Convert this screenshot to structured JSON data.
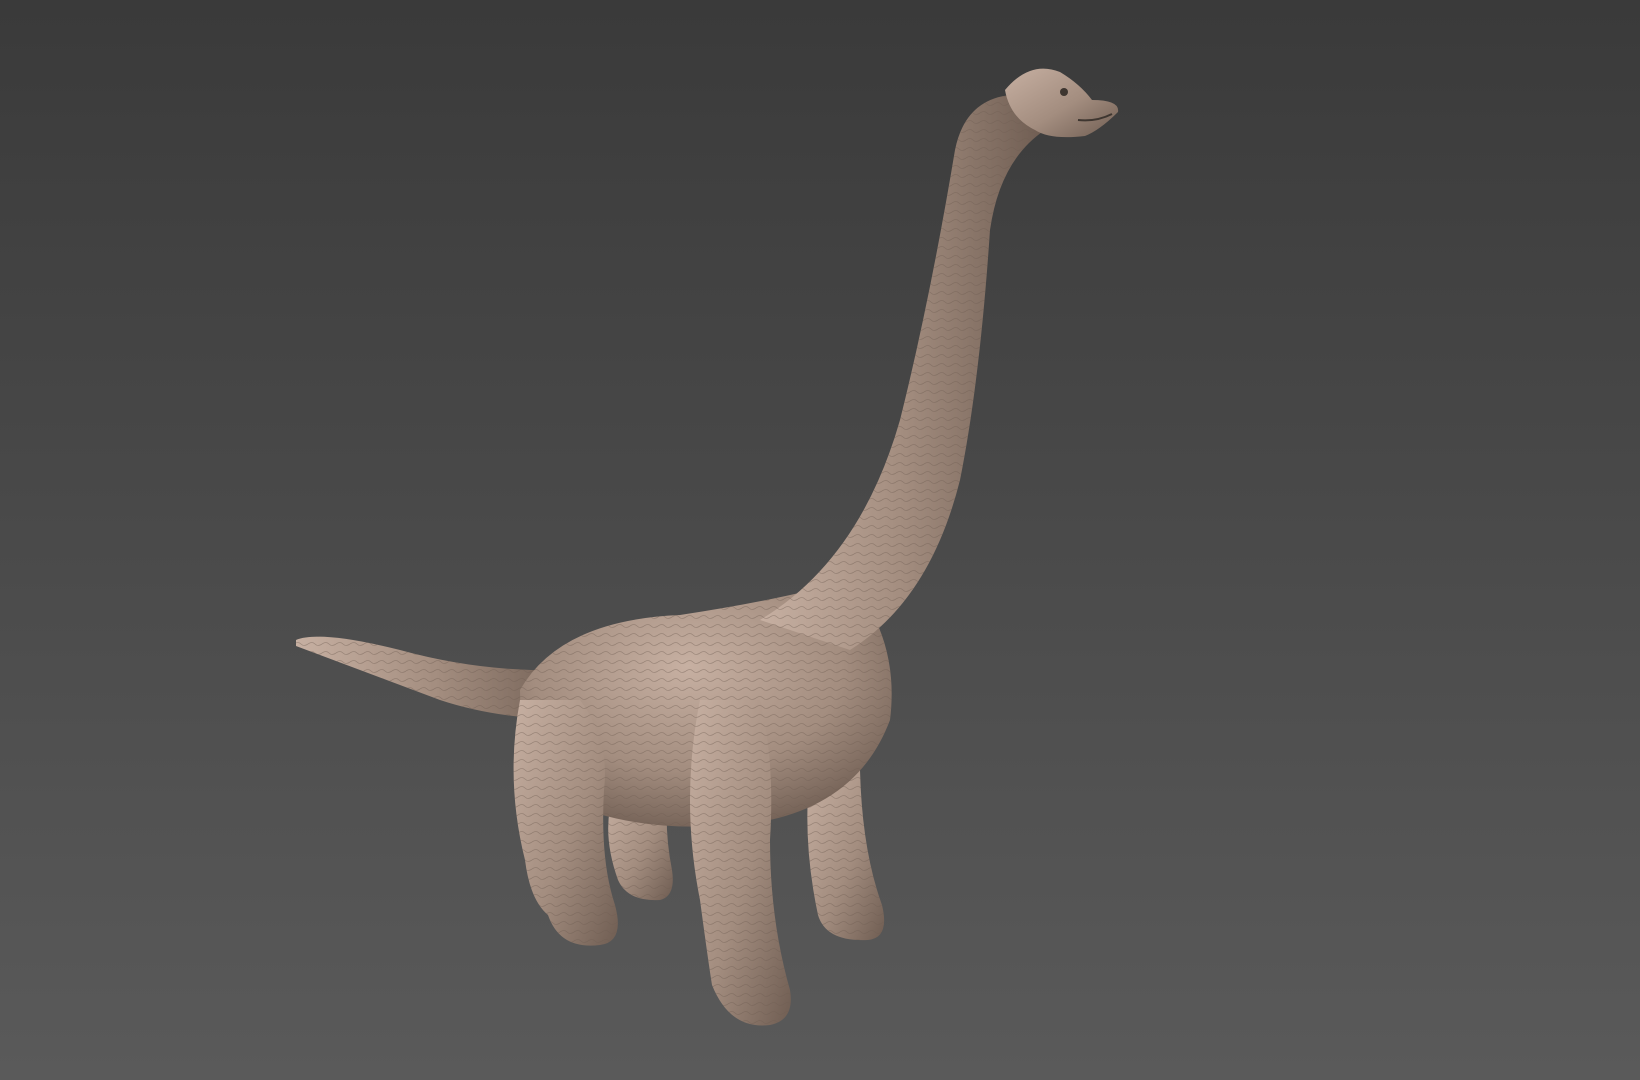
{
  "viewport": {
    "background_top": "#3a3a3a",
    "background_bottom": "#5a5a5a"
  },
  "model": {
    "name": "brachiosaurus-sculpt",
    "skin_color": "#a38d7f",
    "skin_light": "#c7b0a2",
    "skin_dark": "#6f5d52",
    "shadow_color": "#3e3630"
  }
}
